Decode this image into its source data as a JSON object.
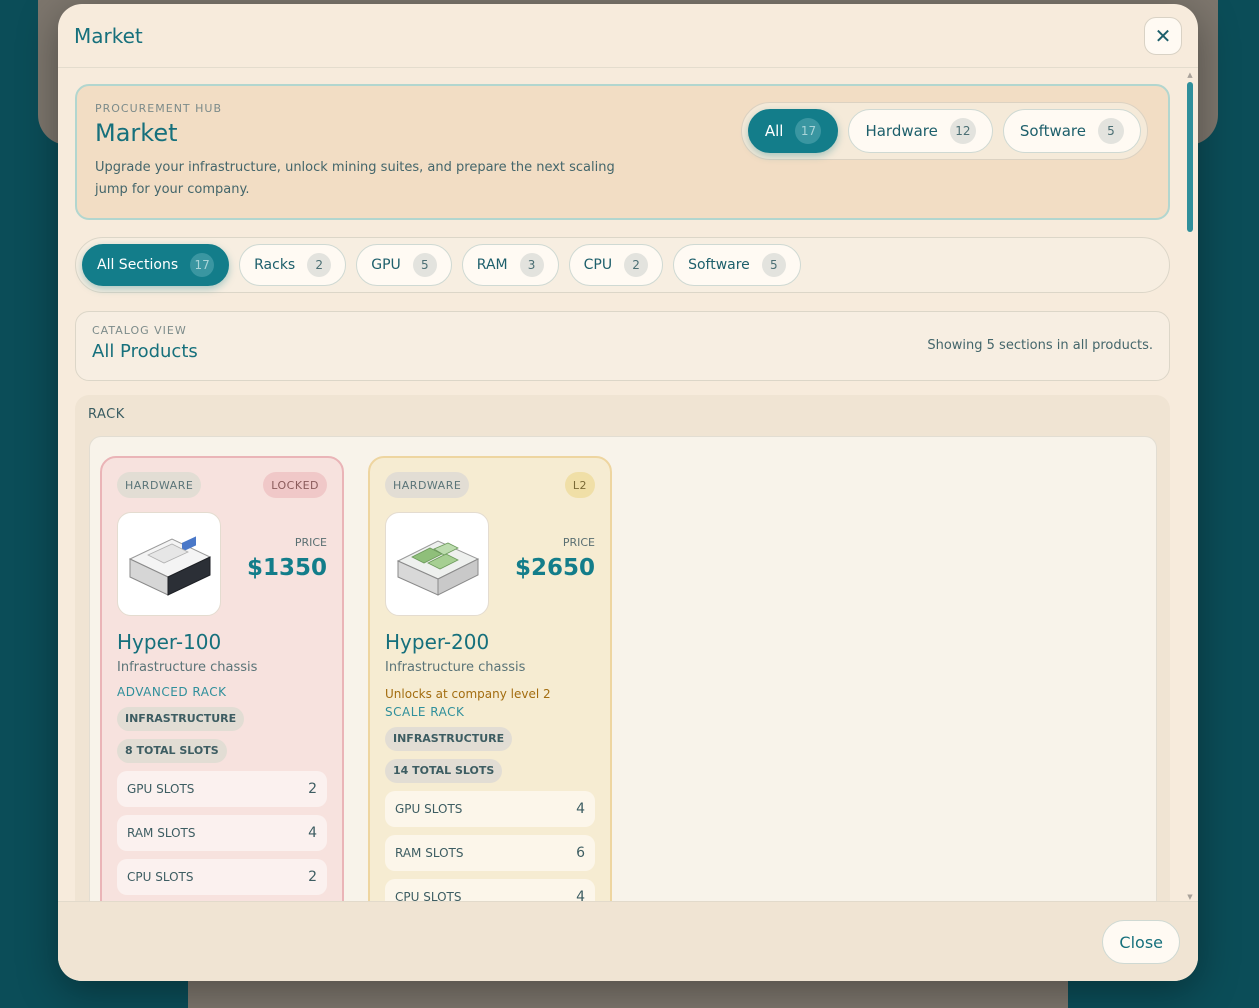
{
  "modal": {
    "title": "Market",
    "close_label": "Close"
  },
  "hub": {
    "eyebrow": "PROCUREMENT HUB",
    "title": "Market",
    "description": "Upgrade your infrastructure, unlock mining suites, and prepare the next scaling jump for your company.",
    "filters": [
      {
        "label": "All",
        "count": "17"
      },
      {
        "label": "Hardware",
        "count": "12"
      },
      {
        "label": "Software",
        "count": "5"
      }
    ]
  },
  "sections": [
    {
      "label": "All Sections",
      "count": "17"
    },
    {
      "label": "Racks",
      "count": "2"
    },
    {
      "label": "GPU",
      "count": "5"
    },
    {
      "label": "RAM",
      "count": "3"
    },
    {
      "label": "CPU",
      "count": "2"
    },
    {
      "label": "Software",
      "count": "5"
    }
  ],
  "catalog": {
    "eyebrow": "CATALOG VIEW",
    "title": "All Products",
    "note": "Showing 5 sections in all products."
  },
  "rack": {
    "label": "RACK",
    "products": [
      {
        "category": "HARDWARE",
        "status": "LOCKED",
        "price_label": "PRICE",
        "price": "$1350",
        "name": "Hyper-100",
        "subtitle": "Infrastructure chassis",
        "type": "ADVANCED RACK",
        "chips": [
          "INFRASTRUCTURE",
          "8 TOTAL SLOTS"
        ],
        "specs": [
          {
            "label": "GPU SLOTS",
            "value": "2"
          },
          {
            "label": "RAM SLOTS",
            "value": "4"
          },
          {
            "label": "CPU SLOTS",
            "value": "2"
          }
        ]
      },
      {
        "category": "HARDWARE",
        "status": "L2",
        "price_label": "PRICE",
        "price": "$2650",
        "name": "Hyper-200",
        "subtitle": "Infrastructure chassis",
        "unlock_note": "Unlocks at company level 2",
        "type": "SCALE RACK",
        "chips": [
          "INFRASTRUCTURE",
          "14 TOTAL SLOTS"
        ],
        "specs": [
          {
            "label": "GPU SLOTS",
            "value": "4"
          },
          {
            "label": "RAM SLOTS",
            "value": "6"
          },
          {
            "label": "CPU SLOTS",
            "value": "4"
          }
        ]
      }
    ]
  },
  "colors": {
    "accent": "#137d8a",
    "locked": "#eab4b7",
    "level": "#eed5a0"
  }
}
